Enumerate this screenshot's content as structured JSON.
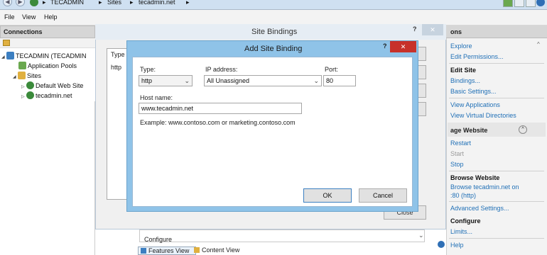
{
  "address": {
    "crumbs": [
      "TECADMIN",
      "Sites",
      "tecadmin.net"
    ],
    "sep": "▸"
  },
  "menu": [
    "File",
    "View",
    "Help"
  ],
  "connections": {
    "title": "Connections",
    "tree": [
      {
        "label": "TECADMIN (TECADMIN",
        "icon": "server-icon",
        "color": "#3c7fc1"
      },
      {
        "label": "Application Pools",
        "icon": "app-pools-icon",
        "color": "#6aa84f"
      },
      {
        "label": "Sites",
        "icon": "folder-icon",
        "color": "#e0b040"
      },
      {
        "label": "Default Web Site",
        "icon": "globe-icon",
        "color": "#3b8a3b"
      },
      {
        "label": "tecadmin.net",
        "icon": "globe-icon",
        "color": "#3b8a3b"
      }
    ]
  },
  "site_bindings": {
    "title": "Site Bindings",
    "help": "?",
    "close": "✕",
    "col_type": "Type",
    "row_type": "http",
    "btn_close": "Close"
  },
  "add_binding": {
    "title": "Add Site Binding",
    "help": "?",
    "close": "✕",
    "type_label": "Type:",
    "type_value": "http",
    "ip_label": "IP address:",
    "ip_value": "All Unassigned",
    "port_label": "Port:",
    "port_value": "80",
    "host_label": "Host name:",
    "host_value": "www.tecadmin.net",
    "example": "Example: www.contoso.com or marketing.contoso.com",
    "ok": "OK",
    "cancel": "Cancel"
  },
  "center": {
    "configure_text": "Configure",
    "features_view": "Features View",
    "content_view": "Content View"
  },
  "actions": {
    "header": "ons",
    "explore": "Explore",
    "edit_permissions": "Edit Permissions...",
    "edit_site": "Edit Site",
    "bindings": "Bindings...",
    "basic_settings": "Basic Settings...",
    "view_applications": "View Applications",
    "view_vdirs": "View Virtual Directories",
    "manage_website": "age Website",
    "restart": "Restart",
    "start": "Start",
    "stop": "Stop",
    "browse_website": "Browse Website",
    "browse_link1": "Browse tecadmin.net on",
    "browse_link2": ":80 (http)",
    "advanced": "Advanced Settings...",
    "configure": "Configure",
    "limits": "Limits...",
    "help": "Help"
  }
}
